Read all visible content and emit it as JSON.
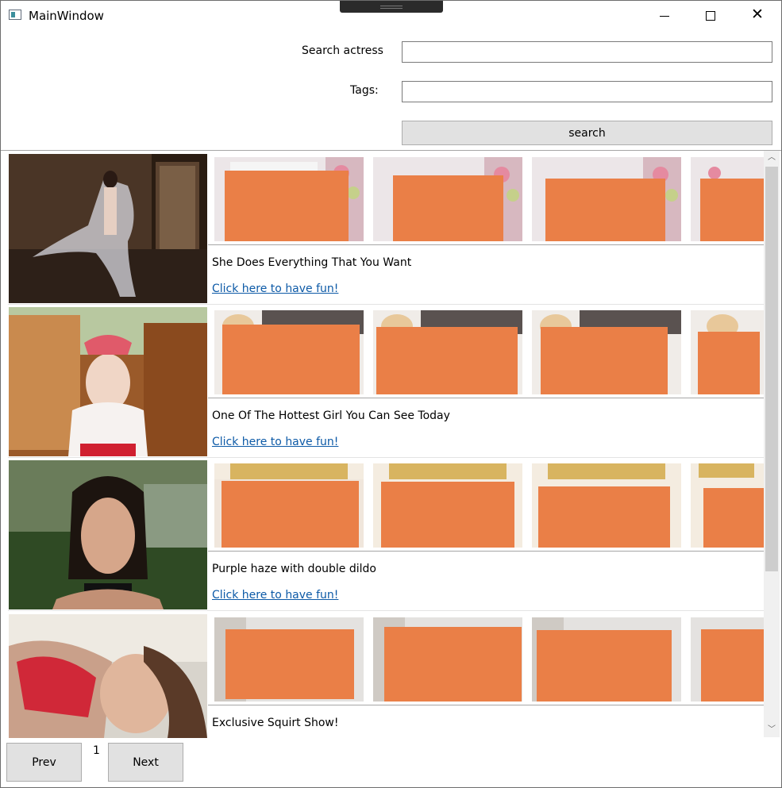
{
  "window": {
    "title": "MainWindow"
  },
  "form": {
    "search_actress_label": "Search actress",
    "search_actress_value": "",
    "tags_label": "Tags:",
    "tags_value": "",
    "search_button": "search"
  },
  "results": [
    {
      "title": "She Does Everything That You Want",
      "link": "Click here to have fun!"
    },
    {
      "title": "One Of The Hottest Girl You Can See Today",
      "link": "Click here to have fun!"
    },
    {
      "title": "Purple haze with double dildo",
      "link": "Click here to have fun!"
    },
    {
      "title": "Exclusive Squirt Show!",
      "link": ""
    }
  ],
  "pagination": {
    "prev": "Prev",
    "page": "1",
    "next": "Next"
  },
  "colors": {
    "redaction": "#ea7f47",
    "link": "#0d5aa7",
    "button": "#e1e1e1"
  }
}
